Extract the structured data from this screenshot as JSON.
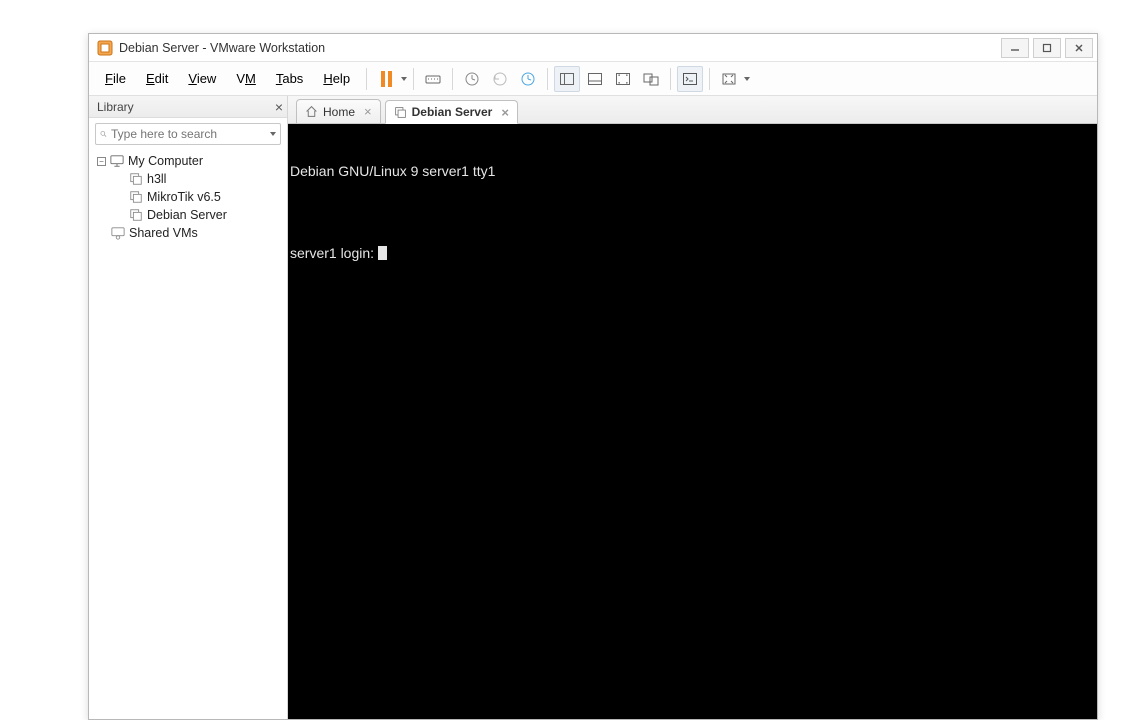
{
  "title": "Debian Server - VMware Workstation",
  "menus": {
    "file": "File",
    "edit": "Edit",
    "view": "View",
    "vm": "VM",
    "tabs": "Tabs",
    "help": "Help"
  },
  "sidebar": {
    "header": "Library",
    "search_placeholder": "Type here to search",
    "root": "My Computer",
    "vms": [
      {
        "label": "h3ll"
      },
      {
        "label": "MikroTik v6.5"
      },
      {
        "label": "Debian Server"
      }
    ],
    "shared": "Shared VMs"
  },
  "tabs": [
    {
      "label": "Home",
      "active": false
    },
    {
      "label": "Debian Server",
      "active": true
    }
  ],
  "console": {
    "line1": "Debian GNU/Linux 9 server1 tty1",
    "blank": "",
    "line2": "server1 login:"
  }
}
